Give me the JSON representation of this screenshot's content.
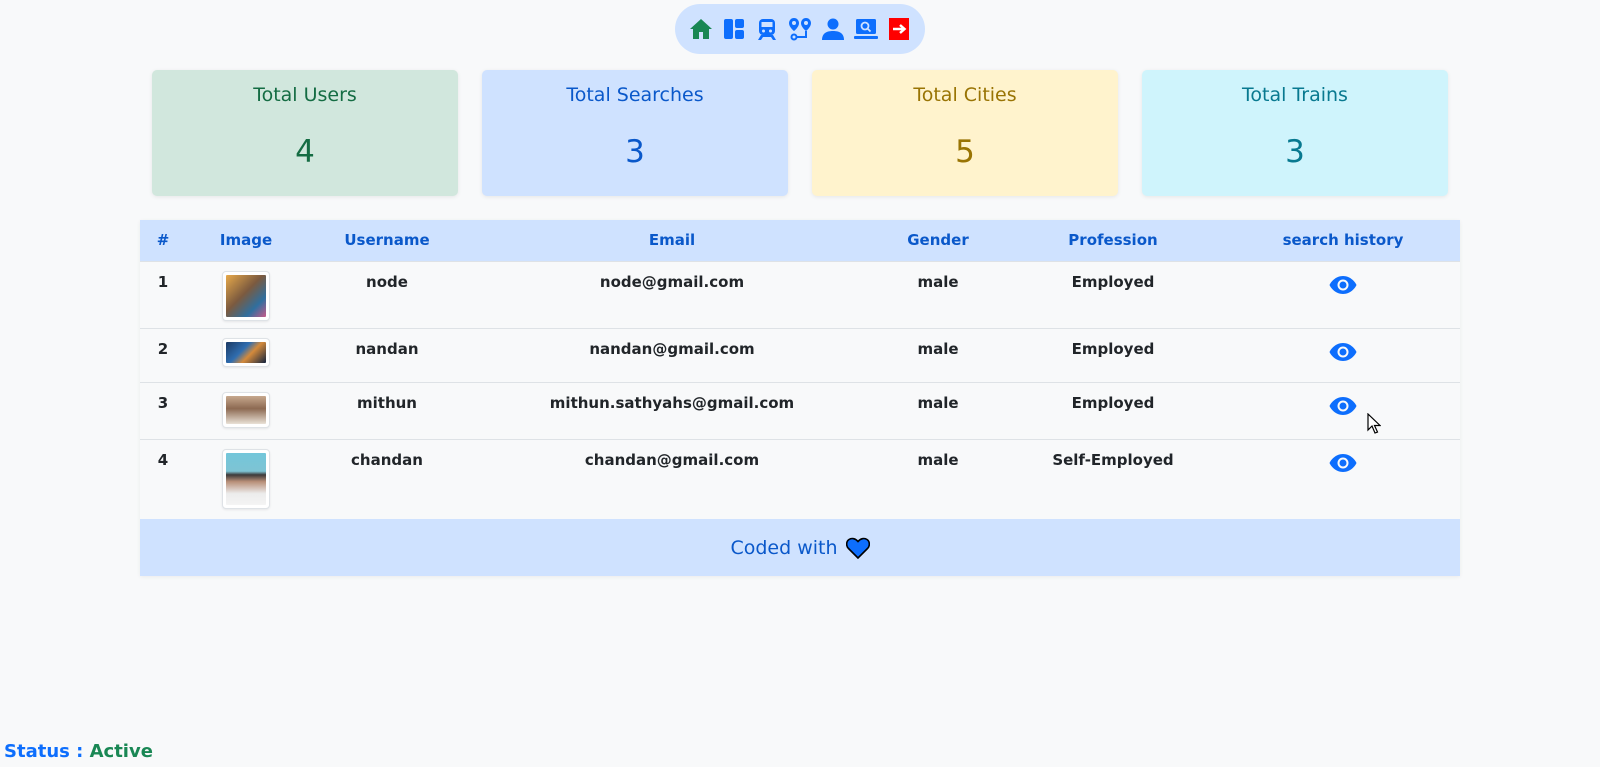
{
  "nav": {
    "icons": [
      "home-icon",
      "dashboard-icon",
      "train-icon",
      "route-icon",
      "user-icon",
      "search-laptop-icon",
      "logout-icon"
    ]
  },
  "stats": {
    "users": {
      "title": "Total Users",
      "value": "4"
    },
    "searches": {
      "title": "Total Searches",
      "value": "3"
    },
    "cities": {
      "title": "Total Cities",
      "value": "5"
    },
    "trains": {
      "title": "Total Trains",
      "value": "3"
    }
  },
  "table": {
    "headers": [
      "#",
      "Image",
      "Username",
      "Email",
      "Gender",
      "Profession",
      "search history"
    ],
    "rows": [
      {
        "index": "1",
        "username": "node",
        "email": "node@gmail.com",
        "gender": "male",
        "profession": "Employed"
      },
      {
        "index": "2",
        "username": "nandan",
        "email": "nandan@gmail.com",
        "gender": "male",
        "profession": "Employed"
      },
      {
        "index": "3",
        "username": "mithun",
        "email": "mithun.sathyahs@gmail.com",
        "gender": "male",
        "profession": "Employed"
      },
      {
        "index": "4",
        "username": "chandan",
        "email": "chandan@gmail.com",
        "gender": "male",
        "profession": "Self-Employed"
      }
    ]
  },
  "footer": {
    "text": "Coded with"
  },
  "status": {
    "label": "Status :",
    "value": "Active"
  },
  "colors": {
    "primary": "#0d6efd",
    "home_green": "#198754",
    "logout_red": "#ff0000",
    "nav_bg": "#cfe2ff"
  }
}
